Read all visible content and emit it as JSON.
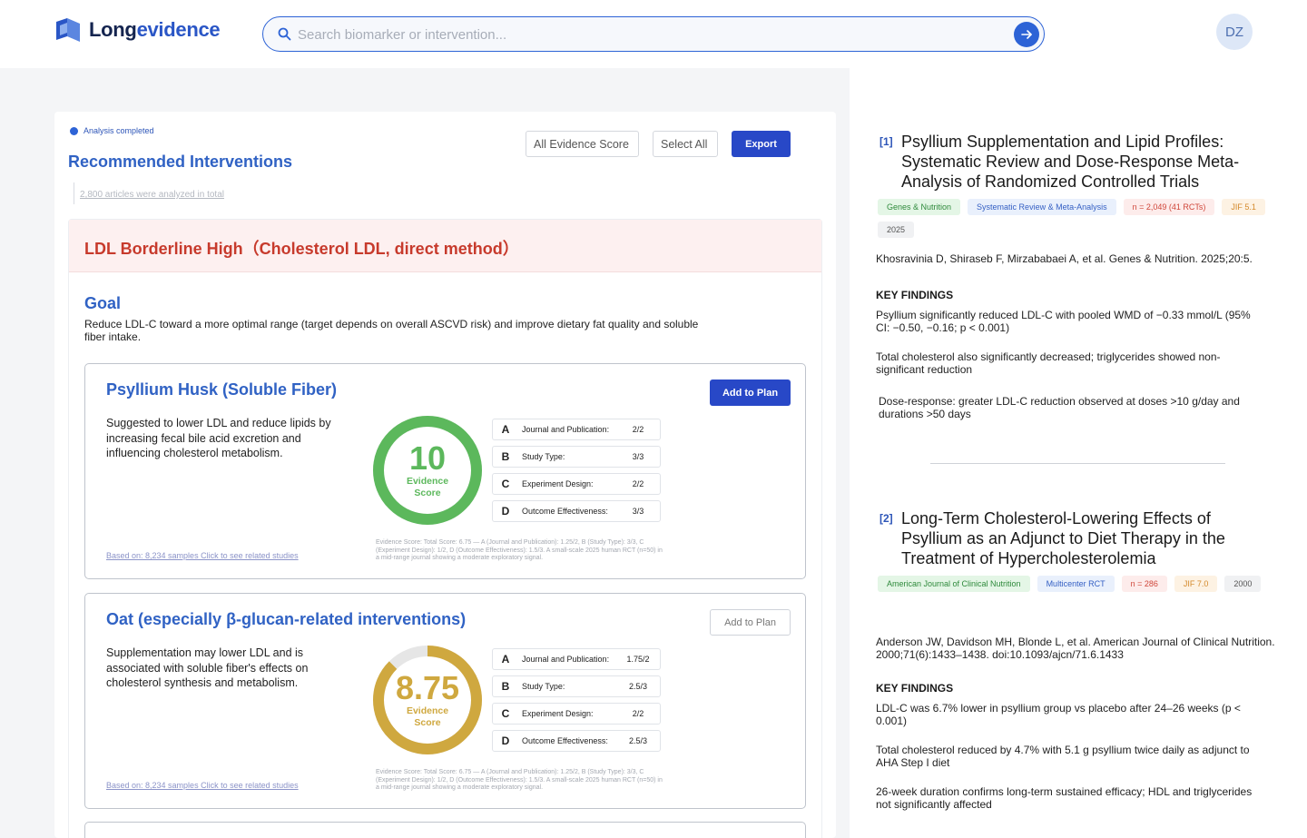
{
  "brand": {
    "name_part1": "Long",
    "name_part2": "evidence"
  },
  "search": {
    "placeholder": "Search biomarker or intervention..."
  },
  "user": {
    "initials": "DZ"
  },
  "analysis": {
    "status": "Analysis completed",
    "title": "Recommended Interventions",
    "articles_note": "2,800 articles were analyzed in total",
    "filters": {
      "evidence_score": "All Evidence Score",
      "select_all": "Select All",
      "export": "Export"
    }
  },
  "condition": {
    "title": "LDL Borderline High（Cholesterol LDL, direct method）",
    "goal_title": "Goal",
    "goal_text": "Reduce LDL-C toward a more optimal range (target depends on overall ASCVD risk) and improve dietary fat quality and soluble fiber intake."
  },
  "interventions": [
    {
      "name": "Psyllium Husk (Soluble Fiber)",
      "add_label": "Add to Plan",
      "description": "Suggested to lower LDL and reduce lipids by increasing fecal bile acid excretion and influencing cholesterol metabolism.",
      "score": "10",
      "score_fraction": 1.0,
      "score_label_1": "Evidence",
      "score_label_2": "Score",
      "color": "#5cb85c",
      "criteria": [
        {
          "letter": "A",
          "name": "Journal and Publication:",
          "value": "2/2"
        },
        {
          "letter": "B",
          "name": "Study Type:",
          "value": "3/3"
        },
        {
          "letter": "C",
          "name": "Experiment Design:",
          "value": "2/2"
        },
        {
          "letter": "D",
          "name": "Outcome Effectiveness:",
          "value": "3/3"
        }
      ],
      "note": "Evidence Score: Total Score: 6.75 — A (Journal and Publication): 1.25/2, B (Study Type): 3/3, C (Experiment Design): 1/2, D (Outcome Effectiveness): 1.5/3. A small-scale 2025 human RCT (n=50) in a mid-range journal showing a moderate exploratory signal.",
      "based_on": "Based on: 8,234 samples Click to see related studies"
    },
    {
      "name": "Oat (especially β-glucan-related interventions)",
      "add_label": "Add to Plan",
      "description": "Supplementation may lower LDL and is associated with soluble fiber's effects on cholesterol synthesis and metabolism.",
      "score": "8.75",
      "score_fraction": 0.875,
      "score_label_1": "Evidence",
      "score_label_2": "Score",
      "color": "#cfa83f",
      "criteria": [
        {
          "letter": "A",
          "name": "Journal and Publication:",
          "value": "1.75/2"
        },
        {
          "letter": "B",
          "name": "Study Type:",
          "value": "2.5/3"
        },
        {
          "letter": "C",
          "name": "Experiment Design:",
          "value": "2/2"
        },
        {
          "letter": "D",
          "name": "Outcome Effectiveness:",
          "value": "2.5/3"
        }
      ],
      "note": "Evidence Score: Total Score: 6.75 — A (Journal and Publication): 1.25/2, B (Study Type): 3/3, C (Experiment Design): 1/2, D (Outcome Effectiveness): 1.5/3. A small-scale 2025 human RCT (n=50) in a mid-range journal showing a moderate exploratory signal.",
      "based_on": "Based on: 8,234 samples Click to see related studies"
    }
  ],
  "references": [
    {
      "num": "[1]",
      "title": "Psyllium Supplementation and Lipid Profiles: Systematic Review and Dose-Response Meta-Analysis of Randomized Controlled Trials",
      "tags": [
        "Genes & Nutrition",
        "Systematic Review & Meta-Analysis",
        "n = 2,049 (41 RCTs)",
        "JIF 5.1",
        "2025"
      ],
      "citation": "Khosravinia D, Shiraseb F, Mirzababaei A, et al. Genes & Nutrition. 2025;20:5.",
      "key_findings_label": "KEY FINDINGS",
      "findings": [
        "Psyllium significantly reduced LDL-C with pooled WMD of −0.33 mmol/L (95% CI: −0.50, −0.16; p < 0.001)",
        "Total cholesterol also significantly decreased; triglycerides showed non-significant reduction",
        "Dose-response: greater LDL-C reduction observed at doses >10 g/day and durations >50 days"
      ]
    },
    {
      "num": "[2]",
      "title": "Long-Term Cholesterol-Lowering Effects of Psyllium as an Adjunct to Diet Therapy in the Treatment of Hypercholesterolemia",
      "tags": [
        "American Journal of Clinical Nutrition",
        "Multicenter RCT",
        "n = 286",
        "JIF 7.0",
        "2000"
      ],
      "citation": "Anderson JW, Davidson MH, Blonde L, et al. American Journal of Clinical Nutrition. 2000;71(6):1433–1438. doi:10.1093/ajcn/71.6.1433",
      "key_findings_label": "KEY FINDINGS",
      "findings": [
        "LDL-C was 6.7% lower in psyllium group vs placebo after 24–26 weeks (p < 0.001)",
        "Total cholesterol reduced by 4.7% with 5.1 g psyllium twice daily as adjunct to AHA Step I diet",
        "26-week duration confirms long-term sustained efficacy; HDL and triglycerides not significantly affected"
      ]
    }
  ]
}
